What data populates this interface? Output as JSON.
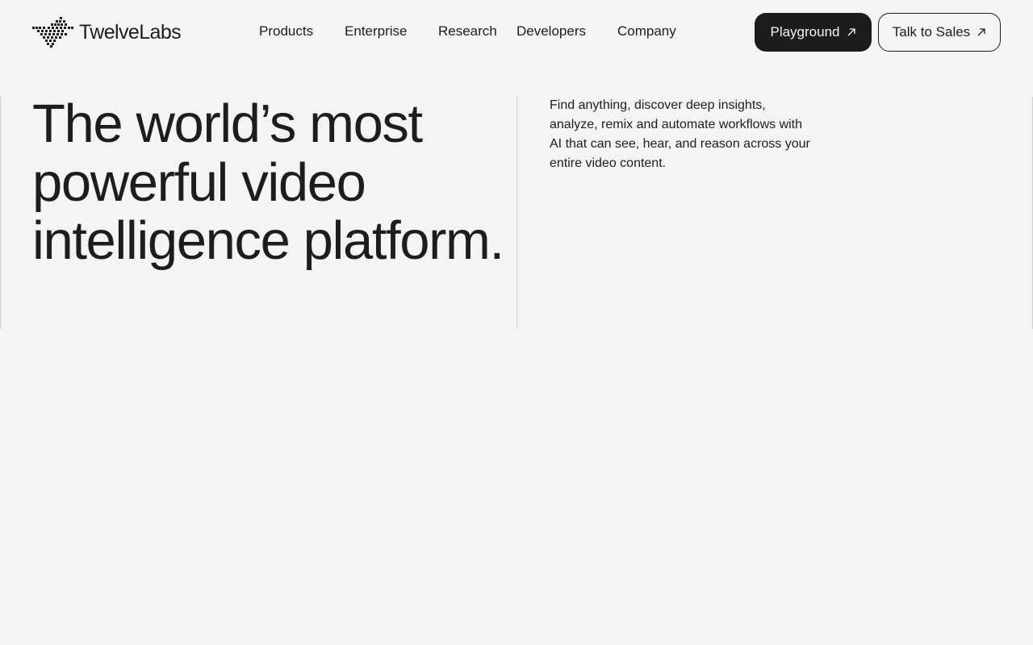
{
  "brand": {
    "name": "TwelveLabs",
    "logo_icon": "pixel-lizard-icon"
  },
  "nav": {
    "items": [
      {
        "label": "Products"
      },
      {
        "label": "Enterprise"
      },
      {
        "label": "Research"
      },
      {
        "label": "Developers"
      },
      {
        "label": "Company"
      }
    ]
  },
  "cta": {
    "playground_label": "Playground",
    "sales_label": "Talk to Sales",
    "arrow_icon": "arrow-up-right-icon"
  },
  "hero": {
    "title": "The world’s most powerful video intelligence platform.",
    "description": "Find anything, discover deep insights, analyze, remix and automate workflows with AI that can see, hear, and reason across your entire video content."
  },
  "colors": {
    "background": "#f4f4f4",
    "text": "#1d1d1d",
    "primary_button": "#1c1c1c",
    "divider": "#d0d0d0"
  }
}
